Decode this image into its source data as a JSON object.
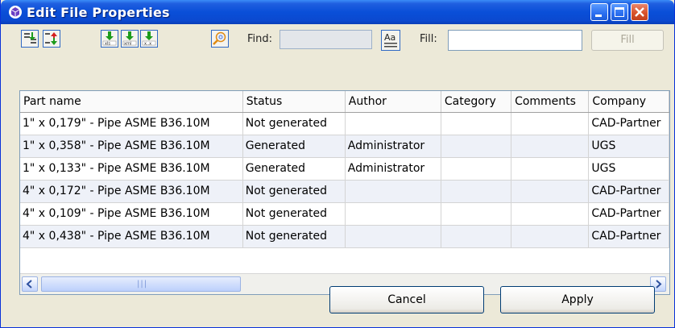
{
  "window": {
    "title": "Edit File Properties"
  },
  "toolbar": {
    "find_label": "Find:",
    "find_value": "",
    "fill_label": "Fill:",
    "fill_value": "",
    "fill_button": "Fill",
    "tools": [
      {
        "name": "import-properties-icon"
      },
      {
        "name": "swap-properties-icon"
      },
      {
        "name": "export-xls-icon"
      },
      {
        "name": "export-xml-icon"
      },
      {
        "name": "export-csv-icon"
      },
      {
        "name": "search-icon"
      },
      {
        "name": "match-case-icon"
      }
    ]
  },
  "table": {
    "columns": [
      "Part name",
      "Status",
      "Author",
      "Category",
      "Comments",
      "Company"
    ],
    "rows": [
      {
        "part_name": "1\" x 0,179\" - Pipe ASME B36.10M",
        "status": "Not generated",
        "author": "",
        "category": "",
        "comments": "",
        "company": "CAD-Partner"
      },
      {
        "part_name": "1\" x 0,358\" - Pipe ASME B36.10M",
        "status": "Generated",
        "author": "Administrator",
        "category": "",
        "comments": "",
        "company": "UGS"
      },
      {
        "part_name": "1\" x 0,133\" - Pipe ASME B36.10M",
        "status": "Generated",
        "author": "Administrator",
        "category": "",
        "comments": "",
        "company": "UGS"
      },
      {
        "part_name": "4\" x 0,172\" - Pipe ASME B36.10M",
        "status": "Not generated",
        "author": "",
        "category": "",
        "comments": "",
        "company": "CAD-Partner"
      },
      {
        "part_name": "4\" x 0,109\" - Pipe ASME B36.10M",
        "status": "Not generated",
        "author": "",
        "category": "",
        "comments": "",
        "company": "CAD-Partner"
      },
      {
        "part_name": "4\" x 0,438\" - Pipe ASME B36.10M",
        "status": "Not generated",
        "author": "",
        "category": "",
        "comments": "",
        "company": "CAD-Partner"
      }
    ]
  },
  "footer": {
    "cancel_label": "Cancel",
    "apply_label": "Apply"
  },
  "colors": {
    "title_bar": "#0a4fd8",
    "dialog_bg": "#ece9d8",
    "close_button": "#d9532c",
    "row_alt": "#eef1f8"
  }
}
